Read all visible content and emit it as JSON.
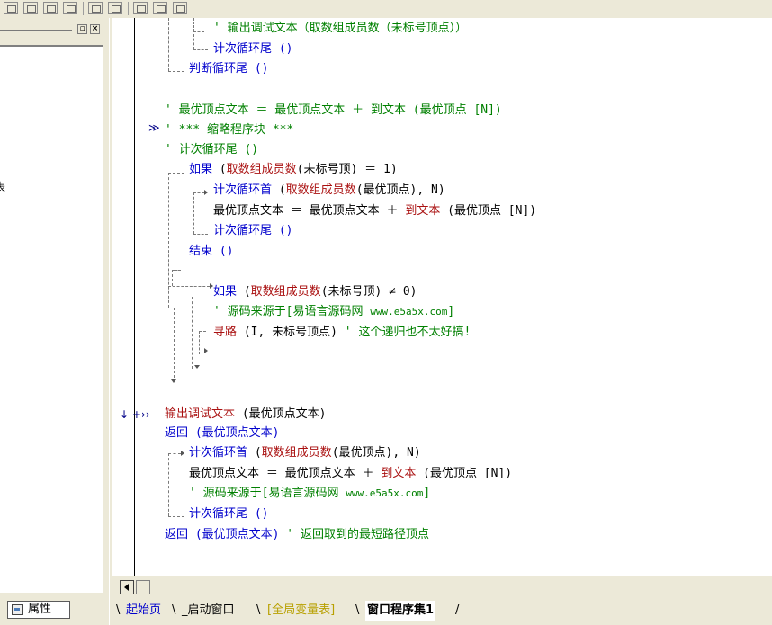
{
  "left_panel": {
    "clipped_text": "表",
    "minimize_glyph": "▫",
    "close_glyph": "×",
    "properties_tab_label": "属性"
  },
  "code": {
    "l1_quote": "'",
    "l1_func": "输出调试文本",
    "l1_arg": "（取数组成员数（未标号顶点））",
    "l2": "计次循环尾 ()",
    "l3": "判断循环尾 ()",
    "l4_quote": "'",
    "l4": "最优顶点文本 ＝ 最优顶点文本 ＋ 到文本 (最优顶点 [N])",
    "l5_mark": "≫",
    "l5": "' *** 缩略程序块 ***",
    "l6": "' 计次循环尾 ()",
    "l7_kw": "如果",
    "l7_fn": "取数组成员数",
    "l7_rest": "(未标号顶) ＝ 1)",
    "l8_kw": "计次循环首",
    "l8_fn": "取数组成员数",
    "l8_rest": "(最优顶点), N)",
    "l9_a": "最优顶点文本 ＝ 最优顶点文本 ＋ ",
    "l9_fn": "到文本",
    "l9_b": " (最优顶点 [N])",
    "l10": "计次循环尾 ()",
    "l11": "结束 ()",
    "l12_kw": "如果",
    "l12_fn": "取数组成员数",
    "l12_rest": "(未标号顶) ≠ 0)",
    "l13_a": "' 源码来源于[易语言源码网 ",
    "l13_url": "www.e5a5x.com",
    "l13_b": "]",
    "l14_fn": "寻路",
    "l14_rest": " (I, 未标号顶点)",
    "l14_comment": " ' 这个递归也不太好搞!",
    "l15_marks": "↓ +››",
    "l15_fn": "输出调试文本",
    "l15_rest": " (最优顶点文本)",
    "l16": "返回 (最优顶点文本)",
    "l17_kw": "计次循环首",
    "l17_fn": "取数组成员数",
    "l17_rest": "(最优顶点), N)",
    "l18_a": "最优顶点文本 ＝ 最优顶点文本 ＋ ",
    "l18_fn": "到文本",
    "l18_b": " (最优顶点 [N])",
    "l19_a": "' 源码来源于[易语言源码网 ",
    "l19_url": "www.e5a5x.com",
    "l19_b": "]",
    "l20": "计次循环尾 ()",
    "l21_a": "返回 (最优顶点文本)",
    "l21_comment": " ' 返回取到的最短路径顶点"
  },
  "tabs": [
    {
      "label": "起始页"
    },
    {
      "label": "_启动窗口"
    },
    {
      "label": "[全局变量表]"
    },
    {
      "label": "窗口程序集1"
    }
  ],
  "colors": {
    "keyword": "#0000cc",
    "function": "#aa1111",
    "comment": "#008000",
    "global_tab": "#b8a000"
  }
}
